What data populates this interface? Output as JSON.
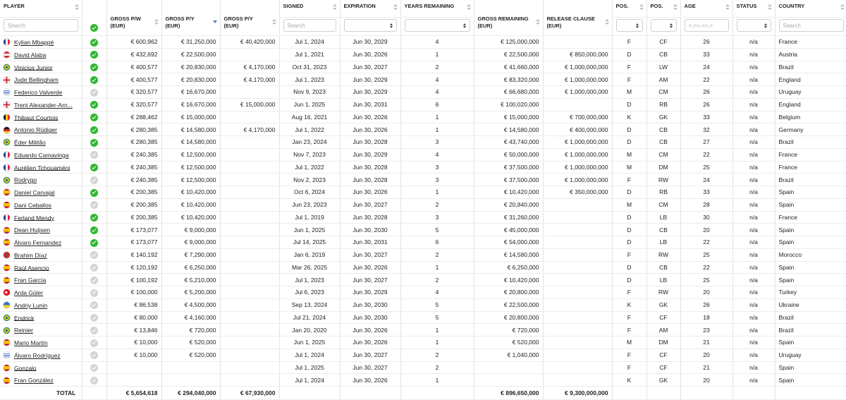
{
  "headers": {
    "player": "PLAYER",
    "gross_pw": "GROSS P/W\n(EUR)",
    "gross_py": "GROSS P/Y\n(EUR)",
    "gross_py2": "GROSS P/Y\n(EUR)",
    "signed": "SIGNED",
    "expiration": "EXPIRATION",
    "years_remaining": "YEARS REMAINING",
    "gross_remaining": "GROSS REMAINING\n(EUR)",
    "release_clause": "RELEASE CLAUSE\n(EUR)",
    "pos1": "POS.",
    "pos2": "POS.",
    "age": "AGE",
    "status": "STATUS",
    "country": "COUNTRY"
  },
  "filters": {
    "player_placeholder": "Search",
    "signed_placeholder": "Search",
    "age_placeholder": ">,>=,<=,<",
    "country_placeholder": "Search"
  },
  "colors": {
    "verified": "#2eb82e",
    "unverified": "#d4d4d4",
    "sort_active": "#5a7ac0"
  },
  "rows": [
    {
      "flag": "france",
      "name": "Kylian Mbappé",
      "verified": true,
      "pw": "€ 600,962",
      "py": "€ 31,250,000",
      "py2": "€ 40,420,000",
      "signed": "Jul 1, 2024",
      "exp": "Jun 30, 2029",
      "years": "4",
      "remaining": "€ 125,000,000",
      "clause": "",
      "pos1": "F",
      "pos2": "CF",
      "age": "26",
      "status": "n/a",
      "country": "France"
    },
    {
      "flag": "austria",
      "name": "David Alaba",
      "verified": true,
      "pw": "€ 432,692",
      "py": "€ 22,500,000",
      "py2": "",
      "signed": "Jul 1, 2021",
      "exp": "Jun 30, 2026",
      "years": "1",
      "remaining": "€ 22,500,000",
      "clause": "€ 850,000,000",
      "pos1": "D",
      "pos2": "CB",
      "age": "33",
      "status": "n/a",
      "country": "Austria"
    },
    {
      "flag": "brazil",
      "name": "Vinicius Junior",
      "verified": true,
      "pw": "€ 400,577",
      "py": "€ 20,830,000",
      "py2": "€ 4,170,000",
      "signed": "Oct 31, 2023",
      "exp": "Jun 30, 2027",
      "years": "2",
      "remaining": "€ 41,660,000",
      "clause": "€ 1,000,000,000",
      "pos1": "F",
      "pos2": "LW",
      "age": "24",
      "status": "n/a",
      "country": "Brazil"
    },
    {
      "flag": "england",
      "name": "Jude Bellingham",
      "verified": true,
      "pw": "€ 400,577",
      "py": "€ 20,830,000",
      "py2": "€ 4,170,000",
      "signed": "Jul 1, 2023",
      "exp": "Jun 30, 2029",
      "years": "4",
      "remaining": "€ 83,320,000",
      "clause": "€ 1,000,000,000",
      "pos1": "F",
      "pos2": "AM",
      "age": "22",
      "status": "n/a",
      "country": "England"
    },
    {
      "flag": "uruguay",
      "name": "Federico Valverde",
      "verified": false,
      "pw": "€ 320,577",
      "py": "€ 16,670,000",
      "py2": "",
      "signed": "Nov 9, 2023",
      "exp": "Jun 30, 2029",
      "years": "4",
      "remaining": "€ 66,680,000",
      "clause": "€ 1,000,000,000",
      "pos1": "M",
      "pos2": "CM",
      "age": "26",
      "status": "n/a",
      "country": "Uruguay"
    },
    {
      "flag": "england",
      "name": "Trent Alexander-Arn...",
      "verified": true,
      "pw": "€ 320,577",
      "py": "€ 16,670,000",
      "py2": "€ 15,000,000",
      "signed": "Jun 1, 2025",
      "exp": "Jun 30, 2031",
      "years": "6",
      "remaining": "€ 100,020,000",
      "clause": "",
      "pos1": "D",
      "pos2": "RB",
      "age": "26",
      "status": "n/a",
      "country": "England"
    },
    {
      "flag": "belgium",
      "name": "Thibaut Courtois",
      "verified": true,
      "pw": "€ 288,462",
      "py": "€ 15,000,000",
      "py2": "",
      "signed": "Aug 16, 2021",
      "exp": "Jun 30, 2026",
      "years": "1",
      "remaining": "€ 15,000,000",
      "clause": "€ 700,000,000",
      "pos1": "K",
      "pos2": "GK",
      "age": "33",
      "status": "n/a",
      "country": "Belgium"
    },
    {
      "flag": "germany",
      "name": "Antonio Rüdiger",
      "verified": true,
      "pw": "€ 280,385",
      "py": "€ 14,580,000",
      "py2": "€ 4,170,000",
      "signed": "Jul 1, 2022",
      "exp": "Jun 30, 2026",
      "years": "1",
      "remaining": "€ 14,580,000",
      "clause": "€ 400,000,000",
      "pos1": "D",
      "pos2": "CB",
      "age": "32",
      "status": "n/a",
      "country": "Germany"
    },
    {
      "flag": "brazil",
      "name": "Éder Militão",
      "verified": true,
      "pw": "€ 280,385",
      "py": "€ 14,580,000",
      "py2": "",
      "signed": "Jan 23, 2024",
      "exp": "Jun 30, 2028",
      "years": "3",
      "remaining": "€ 43,740,000",
      "clause": "€ 1,000,000,000",
      "pos1": "D",
      "pos2": "CB",
      "age": "27",
      "status": "n/a",
      "country": "Brazil"
    },
    {
      "flag": "france",
      "name": "Eduardo Camavinga",
      "verified": false,
      "pw": "€ 240,385",
      "py": "€ 12,500,000",
      "py2": "",
      "signed": "Nov 7, 2023",
      "exp": "Jun 30, 2029",
      "years": "4",
      "remaining": "€ 50,000,000",
      "clause": "€ 1,000,000,000",
      "pos1": "M",
      "pos2": "CM",
      "age": "22",
      "status": "n/a",
      "country": "France"
    },
    {
      "flag": "france",
      "name": "Aurélien Tchouaméni",
      "verified": true,
      "pw": "€ 240,385",
      "py": "€ 12,500,000",
      "py2": "",
      "signed": "Jul 1, 2022",
      "exp": "Jun 30, 2028",
      "years": "3",
      "remaining": "€ 37,500,000",
      "clause": "€ 1,000,000,000",
      "pos1": "M",
      "pos2": "DM",
      "age": "25",
      "status": "n/a",
      "country": "France"
    },
    {
      "flag": "brazil",
      "name": "Rodrygo",
      "verified": false,
      "pw": "€ 240,385",
      "py": "€ 12,500,000",
      "py2": "",
      "signed": "Nov 2, 2023",
      "exp": "Jun 30, 2028",
      "years": "3",
      "remaining": "€ 37,500,000",
      "clause": "€ 1,000,000,000",
      "pos1": "F",
      "pos2": "RW",
      "age": "24",
      "status": "n/a",
      "country": "Brazil"
    },
    {
      "flag": "spain",
      "name": "Daniel Carvajal",
      "verified": true,
      "pw": "€ 200,385",
      "py": "€ 10,420,000",
      "py2": "",
      "signed": "Oct 6, 2024",
      "exp": "Jun 30, 2026",
      "years": "1",
      "remaining": "€ 10,420,000",
      "clause": "€ 350,000,000",
      "pos1": "D",
      "pos2": "RB",
      "age": "33",
      "status": "n/a",
      "country": "Spain"
    },
    {
      "flag": "spain",
      "name": "Dani Ceballos",
      "verified": false,
      "pw": "€ 200,385",
      "py": "€ 10,420,000",
      "py2": "",
      "signed": "Jun 23, 2023",
      "exp": "Jun 30, 2027",
      "years": "2",
      "remaining": "€ 20,840,000",
      "clause": "",
      "pos1": "M",
      "pos2": "CM",
      "age": "28",
      "status": "n/a",
      "country": "Spain"
    },
    {
      "flag": "france",
      "name": "Ferland Mendy",
      "verified": true,
      "pw": "€ 200,385",
      "py": "€ 10,420,000",
      "py2": "",
      "signed": "Jul 1, 2019",
      "exp": "Jun 30, 2028",
      "years": "3",
      "remaining": "€ 31,260,000",
      "clause": "",
      "pos1": "D",
      "pos2": "LB",
      "age": "30",
      "status": "n/a",
      "country": "France"
    },
    {
      "flag": "spain",
      "name": "Dean Huijsen",
      "verified": true,
      "pw": "€ 173,077",
      "py": "€ 9,000,000",
      "py2": "",
      "signed": "Jun 1, 2025",
      "exp": "Jun 30, 2030",
      "years": "5",
      "remaining": "€ 45,000,000",
      "clause": "",
      "pos1": "D",
      "pos2": "CB",
      "age": "20",
      "status": "n/a",
      "country": "Spain"
    },
    {
      "flag": "spain",
      "name": "Álvaro Fernandez",
      "verified": true,
      "pw": "€ 173,077",
      "py": "€ 9,000,000",
      "py2": "",
      "signed": "Jul 14, 2025",
      "exp": "Jun 30, 2031",
      "years": "6",
      "remaining": "€ 54,000,000",
      "clause": "",
      "pos1": "D",
      "pos2": "LB",
      "age": "22",
      "status": "n/a",
      "country": "Spain"
    },
    {
      "flag": "morocco",
      "name": "Brahim Díaz",
      "verified": false,
      "pw": "€ 140,192",
      "py": "€ 7,290,000",
      "py2": "",
      "signed": "Jan 6, 2019",
      "exp": "Jun 30, 2027",
      "years": "2",
      "remaining": "€ 14,580,000",
      "clause": "",
      "pos1": "F",
      "pos2": "RW",
      "age": "25",
      "status": "n/a",
      "country": "Morocco"
    },
    {
      "flag": "spain",
      "name": "Raúl Asencio",
      "verified": false,
      "pw": "€ 120,192",
      "py": "€ 6,250,000",
      "py2": "",
      "signed": "Mar 26, 2025",
      "exp": "Jun 30, 2026",
      "years": "1",
      "remaining": "€ 6,250,000",
      "clause": "",
      "pos1": "D",
      "pos2": "CB",
      "age": "22",
      "status": "n/a",
      "country": "Spain"
    },
    {
      "flag": "spain",
      "name": "Fran García",
      "verified": false,
      "pw": "€ 100,192",
      "py": "€ 5,210,000",
      "py2": "",
      "signed": "Jul 1, 2023",
      "exp": "Jun 30, 2027",
      "years": "2",
      "remaining": "€ 10,420,000",
      "clause": "",
      "pos1": "D",
      "pos2": "LB",
      "age": "25",
      "status": "n/a",
      "country": "Spain"
    },
    {
      "flag": "turkey",
      "name": "Arda Güler",
      "verified": false,
      "pw": "€ 100,000",
      "py": "€ 5,200,000",
      "py2": "",
      "signed": "Jul 6, 2023",
      "exp": "Jun 30, 2029",
      "years": "4",
      "remaining": "€ 20,800,000",
      "clause": "",
      "pos1": "F",
      "pos2": "RW",
      "age": "20",
      "status": "n/a",
      "country": "Turkey"
    },
    {
      "flag": "ukraine",
      "name": "Andriy Lunin",
      "verified": false,
      "pw": "€ 86,538",
      "py": "€ 4,500,000",
      "py2": "",
      "signed": "Sep 13, 2024",
      "exp": "Jun 30, 2030",
      "years": "5",
      "remaining": "€ 22,500,000",
      "clause": "",
      "pos1": "K",
      "pos2": "GK",
      "age": "26",
      "status": "n/a",
      "country": "Ukraine"
    },
    {
      "flag": "brazil",
      "name": "Endrick",
      "verified": false,
      "pw": "€ 80,000",
      "py": "€ 4,160,000",
      "py2": "",
      "signed": "Jul 21, 2024",
      "exp": "Jun 30, 2030",
      "years": "5",
      "remaining": "€ 20,800,000",
      "clause": "",
      "pos1": "F",
      "pos2": "CF",
      "age": "18",
      "status": "n/a",
      "country": "Brazil"
    },
    {
      "flag": "brazil",
      "name": "Reinier",
      "verified": false,
      "pw": "€ 13,846",
      "py": "€ 720,000",
      "py2": "",
      "signed": "Jan 20, 2020",
      "exp": "Jun 30, 2026",
      "years": "1",
      "remaining": "€ 720,000",
      "clause": "",
      "pos1": "F",
      "pos2": "AM",
      "age": "23",
      "status": "n/a",
      "country": "Brazil"
    },
    {
      "flag": "spain",
      "name": "Mario Martín",
      "verified": false,
      "pw": "€ 10,000",
      "py": "€ 520,000",
      "py2": "",
      "signed": "Jun 1, 2025",
      "exp": "Jun 30, 2026",
      "years": "1",
      "remaining": "€ 520,000",
      "clause": "",
      "pos1": "M",
      "pos2": "DM",
      "age": "21",
      "status": "n/a",
      "country": "Spain"
    },
    {
      "flag": "uruguay",
      "name": "Álvaro Rodríguez",
      "verified": false,
      "pw": "€ 10,000",
      "py": "€ 520,000",
      "py2": "",
      "signed": "Jul 1, 2024",
      "exp": "Jun 30, 2027",
      "years": "2",
      "remaining": "€ 1,040,000",
      "clause": "",
      "pos1": "F",
      "pos2": "CF",
      "age": "20",
      "status": "n/a",
      "country": "Uruguay"
    },
    {
      "flag": "spain",
      "name": "Gonzalo",
      "verified": false,
      "pw": "",
      "py": "",
      "py2": "",
      "signed": "Jul 1, 2025",
      "exp": "Jun 30, 2027",
      "years": "2",
      "remaining": "",
      "clause": "",
      "pos1": "F",
      "pos2": "CF",
      "age": "21",
      "status": "n/a",
      "country": "Spain"
    },
    {
      "flag": "spain",
      "name": "Fran González",
      "verified": false,
      "pw": "",
      "py": "",
      "py2": "",
      "signed": "Jul 1, 2024",
      "exp": "Jun 30, 2026",
      "years": "1",
      "remaining": "",
      "clause": "",
      "pos1": "K",
      "pos2": "GK",
      "age": "20",
      "status": "n/a",
      "country": "Spain"
    }
  ],
  "totals": {
    "label": "TOTAL",
    "pw": "€ 5,654,618",
    "py": "€ 294,040,000",
    "py2": "€ 67,930,000",
    "remaining": "€ 896,650,000",
    "clause": "€ 9,300,000,000"
  }
}
